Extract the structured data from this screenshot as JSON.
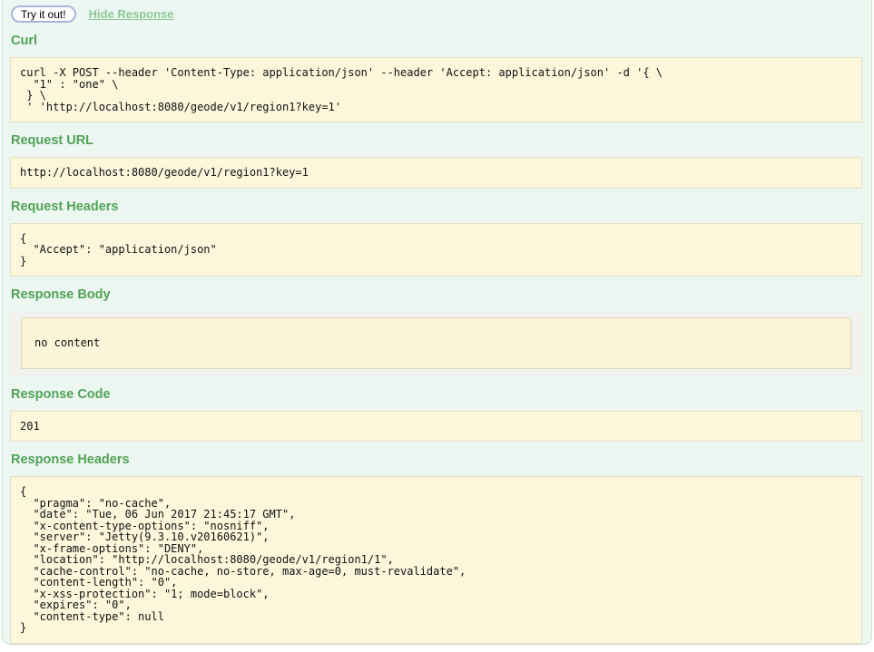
{
  "actions": {
    "try_it_out_label": "Try it out!",
    "hide_response_label": "Hide Response"
  },
  "sections": {
    "curl": {
      "heading": "Curl",
      "content": "curl -X POST --header 'Content-Type: application/json' --header 'Accept: application/json' -d '{ \\ \n  \"1\" : \"one\" \\ \n } \\ \n ' 'http://localhost:8080/geode/v1/region1?key=1'"
    },
    "request_url": {
      "heading": "Request URL",
      "content": "http://localhost:8080/geode/v1/region1?key=1"
    },
    "request_headers": {
      "heading": "Request Headers",
      "content": "{\n  \"Accept\": \"application/json\"\n}"
    },
    "response_body": {
      "heading": "Response Body",
      "content": "no content"
    },
    "response_code": {
      "heading": "Response Code",
      "content": "201"
    },
    "response_headers": {
      "heading": "Response Headers",
      "content": "{\n  \"pragma\": \"no-cache\",\n  \"date\": \"Tue, 06 Jun 2017 21:45:17 GMT\",\n  \"x-content-type-options\": \"nosniff\",\n  \"server\": \"Jetty(9.3.10.v20160621)\",\n  \"x-frame-options\": \"DENY\",\n  \"location\": \"http://localhost:8080/geode/v1/region1/1\",\n  \"cache-control\": \"no-cache, no-store, max-age=0, must-revalidate\",\n  \"content-length\": \"0\",\n  \"x-xss-protection\": \"1; mode=block\",\n  \"expires\": \"0\",\n  \"content-type\": null\n}"
    }
  },
  "colors": {
    "panel_background": "#ebf7f0",
    "panel_border": "#c8dcca",
    "heading_green": "#53a158",
    "hide_link_green": "#8fc79a",
    "code_block_background": "#fcf6db",
    "code_block_border": "#e5e0c6",
    "response_body_shadow": "#f1f1ee",
    "button_border_blue": "#a6b7de"
  }
}
